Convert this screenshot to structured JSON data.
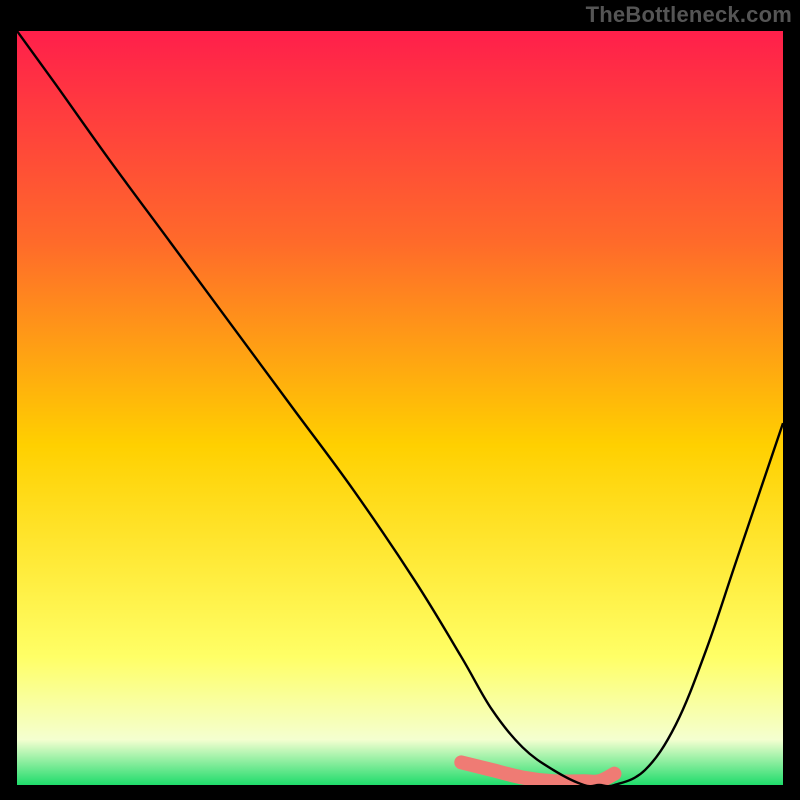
{
  "brand": "TheBottleneck.com",
  "colors": {
    "gradient_top": "#ff1f4b",
    "gradient_mid1": "#ff6a2a",
    "gradient_mid2": "#ffd000",
    "gradient_low1": "#ffff66",
    "gradient_low2": "#f4ffd0",
    "gradient_bottom": "#1fdc6b",
    "curve": "#000000",
    "highlight": "#ef7b74"
  },
  "chart_data": {
    "type": "line",
    "title": "",
    "xlabel": "",
    "ylabel": "",
    "xlim": [
      0,
      100
    ],
    "ylim": [
      0,
      100
    ],
    "series": [
      {
        "name": "bottleneck-curve",
        "x": [
          0,
          5,
          12,
          20,
          28,
          36,
          44,
          52,
          58,
          62,
          66,
          70,
          74,
          76,
          78,
          82,
          86,
          90,
          94,
          100
        ],
        "values": [
          100,
          93,
          83,
          72,
          61,
          50,
          39,
          27,
          17,
          10,
          5,
          2,
          0,
          0,
          0,
          2,
          8,
          18,
          30,
          48
        ]
      }
    ],
    "highlight_segment": {
      "x": [
        58,
        62,
        66,
        70,
        74,
        76,
        78
      ],
      "values": [
        3,
        2,
        1,
        0.5,
        0.5,
        0.5,
        1.5
      ]
    }
  }
}
